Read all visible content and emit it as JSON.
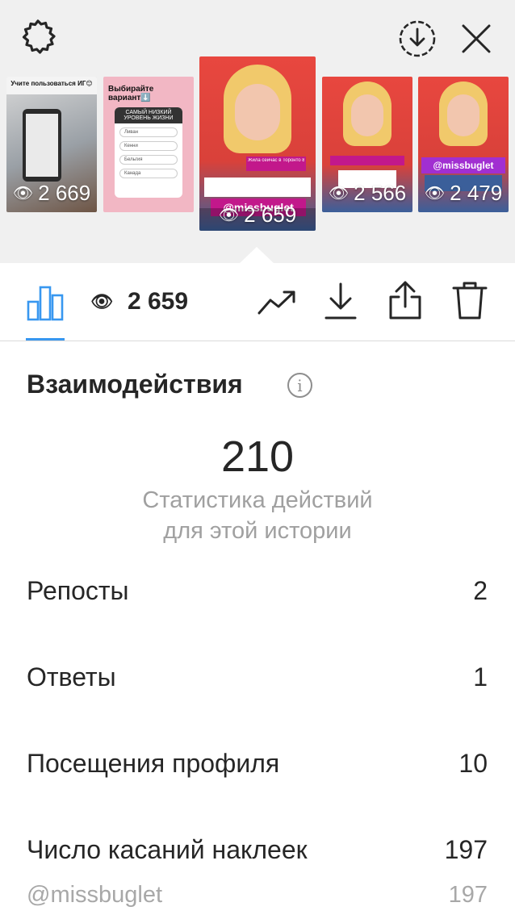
{
  "header": {
    "settings_icon": "gear-icon",
    "download_icon": "download-circle-icon",
    "close_icon": "close-icon"
  },
  "stories": [
    {
      "views": "2 669",
      "caption": "Учите пользоваться ИГ😊"
    },
    {
      "views": "",
      "caption": "Выбирайте вариант⬇️",
      "sticker_title": "САМЫЙ НИЗКИЙ УРОВЕНЬ ЖИЗНИ",
      "options": [
        "Ливан",
        "Кенни",
        "Бельгия",
        "Канада"
      ]
    },
    {
      "views": "2 659",
      "caption": "Жила сейчас в Торонто 8,5 лет",
      "mention": "@missbuglet"
    },
    {
      "views": "2 566",
      "caption": ""
    },
    {
      "views": "2 479",
      "mention": "@missbuglet"
    }
  ],
  "toolbar": {
    "views_count": "2 659",
    "active_tab": "insights"
  },
  "interactions": {
    "title": "Взаимодействия",
    "total": "210",
    "subtitle_line1": "Статистика действий",
    "subtitle_line2": "для этой истории",
    "rows": [
      {
        "label": "Репосты",
        "value": "2"
      },
      {
        "label": "Ответы",
        "value": "1"
      },
      {
        "label": "Посещения профиля",
        "value": "10"
      },
      {
        "label": "Число касаний наклеек",
        "value": "197"
      }
    ],
    "sub_row": {
      "label": "@missbuglet",
      "value": "197"
    }
  },
  "colors": {
    "accent": "#3897f0",
    "story_bg": "#e8473f",
    "mention_bg": "#c2188b"
  }
}
